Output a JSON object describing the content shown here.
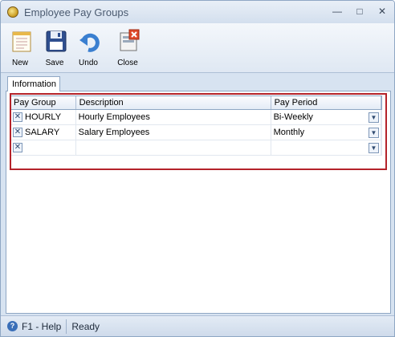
{
  "window": {
    "title": "Employee Pay Groups"
  },
  "toolbar": {
    "new_label": "New",
    "save_label": "Save",
    "undo_label": "Undo",
    "close_label": "Close"
  },
  "tabs": [
    {
      "label": "Information"
    }
  ],
  "grid": {
    "columns": [
      "Pay Group",
      "Description",
      "Pay Period"
    ],
    "rows": [
      {
        "pay_group": "HOURLY",
        "description": "Hourly Employees",
        "pay_period": "Bi-Weekly"
      },
      {
        "pay_group": "SALARY",
        "description": "Salary Employees",
        "pay_period": "Monthly"
      },
      {
        "pay_group": "",
        "description": "",
        "pay_period": ""
      }
    ]
  },
  "statusbar": {
    "help": "F1 - Help",
    "status": "Ready"
  },
  "colors": {
    "highlight": "#b4232a",
    "accent": "#3a6fb8"
  }
}
